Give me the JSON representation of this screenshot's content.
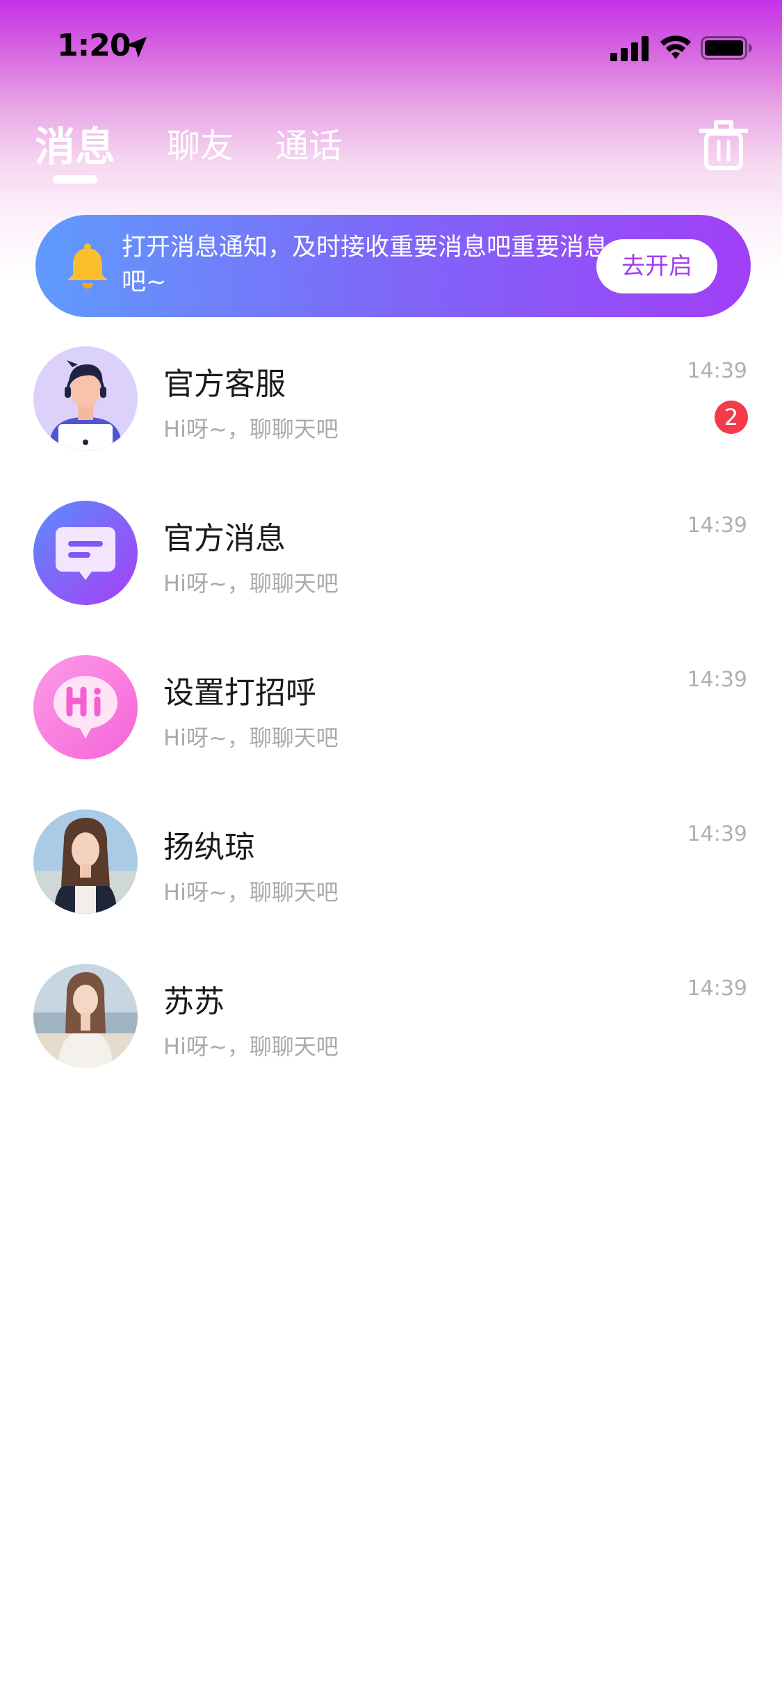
{
  "status_bar": {
    "time": "1:20",
    "icons": [
      "location-arrow-icon",
      "cellular-signal-icon",
      "wifi-icon",
      "battery-icon"
    ]
  },
  "header": {
    "tabs": [
      {
        "label": "消息",
        "active": true
      },
      {
        "label": "聊友",
        "active": false
      },
      {
        "label": "通话",
        "active": false
      }
    ],
    "trash_icon": "trash-icon"
  },
  "banner": {
    "icon": "bell-icon",
    "text": "打开消息通知，及时接收重要消息吧重要消息吧~",
    "button_label": "去开启"
  },
  "chats": [
    {
      "name": "官方客服",
      "preview": "Hi呀~，聊聊天吧",
      "time": "14:39",
      "unread": "2",
      "avatar": "customer-service-avatar"
    },
    {
      "name": "官方消息",
      "preview": "Hi呀~，聊聊天吧",
      "time": "14:39",
      "avatar": "official-message-avatar"
    },
    {
      "name": "设置打招呼",
      "preview": "Hi呀~，聊聊天吧",
      "time": "14:39",
      "avatar": "hi-greeting-avatar"
    },
    {
      "name": "扬纨琼",
      "preview": "Hi呀~，聊聊天吧",
      "time": "14:39",
      "avatar": "user-photo-avatar"
    },
    {
      "name": "苏苏",
      "preview": "Hi呀~，聊聊天吧",
      "time": "14:39",
      "avatar": "user-photo-avatar"
    }
  ],
  "colors": {
    "accent_purple": "#a13ff7",
    "banner_start": "#5f9bfc",
    "badge_red": "#f53a4a",
    "bell_yellow": "#fbbf2e"
  }
}
